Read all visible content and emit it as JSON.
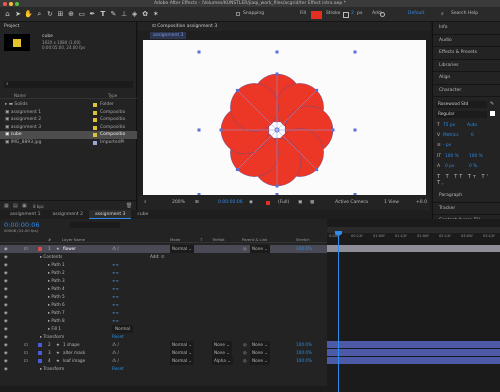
{
  "window": {
    "title": "Adobe After Effects - /Volumes/KUNSTLER/jiaqi_work_files/acgrid/ter Effect intro.aep *"
  },
  "toolbar": {
    "snapping": "Snapping",
    "fill": "Fill",
    "stroke": "Stroke",
    "stroke_width": "2",
    "px": "px",
    "add": "Add:",
    "default": "Default",
    "search": "Search Help"
  },
  "project": {
    "tab": "Project",
    "comp_name": "cube",
    "comp_info": "1920 x 1080 (1.00)",
    "comp_info2": "0:00:05:00, 24.00 fps",
    "search_placeholder": "",
    "col_name": "Name",
    "col_type": "Type",
    "items": [
      {
        "name": "Solids",
        "type": "Folder",
        "color": "#d8c33a"
      },
      {
        "name": "assignment 1",
        "type": "Compositio",
        "color": "#d8c33a"
      },
      {
        "name": "assignment 2",
        "type": "Compositio",
        "color": "#d8c33a"
      },
      {
        "name": "assignment 3",
        "type": "Compositio",
        "color": "#d8c33a"
      },
      {
        "name": "cube",
        "type": "Compositio",
        "color": "#d8c33a"
      },
      {
        "name": "IMG_8893.jpg",
        "type": "ImportedPl",
        "color": "#a2a2d6"
      }
    ],
    "bpc": "8 bpc"
  },
  "viewer": {
    "tab": "Composition assignment 3",
    "breadcrumb": "assignment 3",
    "zoom": "200%",
    "time": "0:00:00:06",
    "quality": "(Full)",
    "camera": "Active Camera",
    "view": "1 View",
    "offset": "+0.0"
  },
  "right_panels": [
    "Info",
    "Audio",
    "Effects & Presets",
    "Libraries",
    "Align",
    "Character"
  ],
  "character": {
    "font": "Rosewood Std",
    "style": "Regular",
    "size": "75 px",
    "leading": "Auto",
    "kerning": "Metrics",
    "tracking": "0",
    "stroke": "- px",
    "vscale": "100 %",
    "hscale": "100 %",
    "baseline": "0 px",
    "tsume": "0 %"
  },
  "right_bottom_panels": [
    "Paragraph",
    "Tracker",
    "Content-Aware Fill"
  ],
  "timeline": {
    "tabs": [
      "assignment 1",
      "assignment 2",
      "assignment 3",
      "cube"
    ],
    "active_tab": "assignment 3",
    "current_time": "0:00:00:06",
    "frame_info": "00006 (24.00 fps)",
    "ruler": [
      "0:00f",
      "00:12f",
      "01:00f",
      "01:12f",
      "02:00f",
      "02:12f",
      "03:00f",
      "03:12f"
    ],
    "columns": [
      "#",
      "Layer Name",
      "Mode",
      "T",
      "TrkMat",
      "Parent & Link",
      "Stretch"
    ],
    "rows": [
      {
        "num": "1",
        "name": "flower",
        "type": "shape",
        "mode": "Normal",
        "trk": "",
        "parent": "None",
        "stretch": "100.0%",
        "selected": true,
        "label": "#d84a4a"
      },
      {
        "num": "",
        "name": "Contents",
        "type": "group",
        "mode": "",
        "trk": "",
        "parent": "",
        "stretch": "",
        "add": "Add:"
      },
      {
        "num": "",
        "name": "Path 1",
        "type": "path"
      },
      {
        "num": "",
        "name": "Path 2",
        "type": "path"
      },
      {
        "num": "",
        "name": "Path 3",
        "type": "path"
      },
      {
        "num": "",
        "name": "Path 4",
        "type": "path"
      },
      {
        "num": "",
        "name": "Path 5",
        "type": "path"
      },
      {
        "num": "",
        "name": "Path 6",
        "type": "path"
      },
      {
        "num": "",
        "name": "Path 7",
        "type": "path"
      },
      {
        "num": "",
        "name": "Path 8",
        "type": "path"
      },
      {
        "num": "",
        "name": "Fill 1",
        "type": "fill",
        "mode": "Normal"
      },
      {
        "num": "",
        "name": "Transform",
        "type": "group",
        "reset": "Reset"
      },
      {
        "num": "2",
        "name": "1 shape",
        "type": "shape",
        "mode": "Normal",
        "trk": "None",
        "parent": "None",
        "stretch": "100.0%",
        "label": "#4a5ad8"
      },
      {
        "num": "3",
        "name": "alter mask",
        "type": "shape",
        "mode": "Normal",
        "trk": "None",
        "parent": "None",
        "stretch": "100.0%",
        "label": "#4a5ad8"
      },
      {
        "num": "4",
        "name": "loaf image",
        "type": "shape",
        "mode": "Normal",
        "trk": "Alpha",
        "parent": "None",
        "stretch": "100.0%",
        "label": "#4a5ad8"
      },
      {
        "num": "",
        "name": "Transform",
        "type": "group",
        "reset": "Reset"
      }
    ]
  },
  "colors": {
    "flower": "#ec3726",
    "handle": "#5a6fd8",
    "accent": "#2d8ceb",
    "red_swatch": "#e22f22",
    "timebar": "#3c4ea8"
  }
}
